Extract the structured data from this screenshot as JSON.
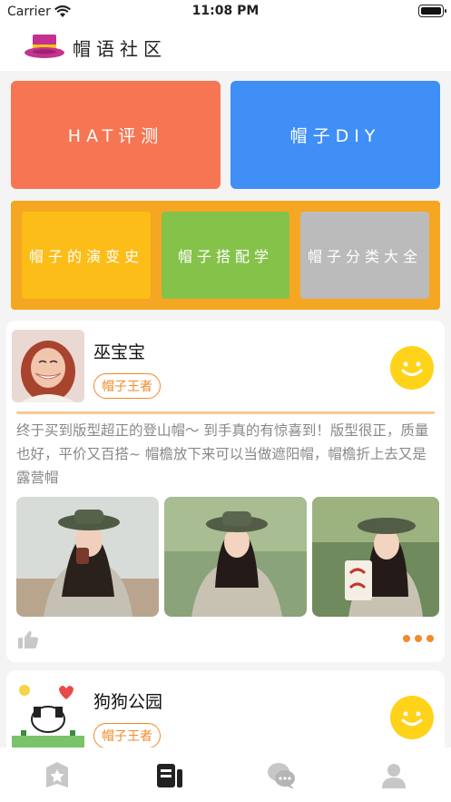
{
  "status_bar": {
    "carrier": "Carrier",
    "time": "11:08 PM"
  },
  "app": {
    "title": "帽语社区",
    "logo_icon": "hat-icon"
  },
  "features": {
    "hat_eval": "HAT评测",
    "hat_diy": "帽子DIY"
  },
  "categories": [
    {
      "label": "帽子的演变史"
    },
    {
      "label": "帽子搭配学"
    },
    {
      "label": "帽子分类大全"
    }
  ],
  "colors": {
    "accent": "#f28a2a",
    "hat_eval_tile": "#f67553",
    "diy_tile": "#3f8ff6",
    "category_panel": "#f5a623",
    "chat_button": "#ffd31a"
  },
  "posts": [
    {
      "user": "巫宝宝",
      "badge": "帽子王者",
      "text": "终于买到版型超正的登山帽～ 到手真的有惊喜到！版型很正，质量也好，平价又百搭~ 帽檐放下来可以当做遮阳帽，帽檐折上去又是露营帽"
    },
    {
      "user": "狗狗公园",
      "badge": "帽子王者"
    }
  ],
  "tab_bar": [
    "home-badge-icon",
    "post-list-icon",
    "chat-bubbles-icon",
    "profile-icon"
  ]
}
